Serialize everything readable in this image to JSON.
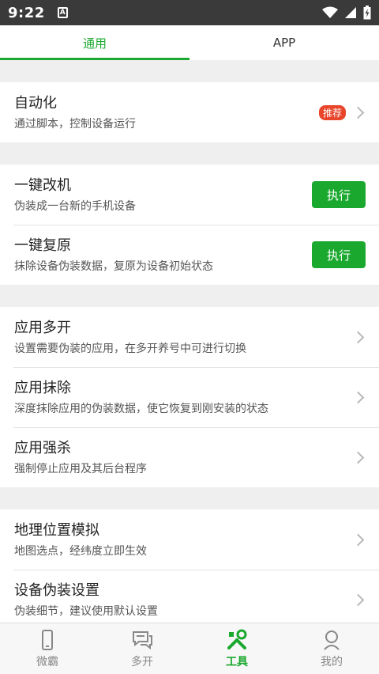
{
  "status": {
    "time": "9:22",
    "sim_icon": "A"
  },
  "tabs": [
    {
      "label": "通用",
      "active": true
    },
    {
      "label": "APP",
      "active": false
    }
  ],
  "automation": {
    "title": "自动化",
    "subtitle": "通过脚本，控制设备运行",
    "badge": "推荐"
  },
  "modify": {
    "title": "一键改机",
    "subtitle": "伪装成一台新的手机设备",
    "button": "执行"
  },
  "restore": {
    "title": "一键复原",
    "subtitle": "抹除设备伪装数据，复原为设备初始状态",
    "button": "执行"
  },
  "multi_open": {
    "title": "应用多开",
    "subtitle": "设置需要伪装的应用，在多开养号中可进行切换"
  },
  "app_erase": {
    "title": "应用抹除",
    "subtitle": "深度抹除应用的伪装数据，使它恢复到刚安装的状态"
  },
  "force_kill": {
    "title": "应用强杀",
    "subtitle": "强制停止应用及其后台程序"
  },
  "geo": {
    "title": "地理位置模拟",
    "subtitle": "地图选点，经纬度立即生效"
  },
  "disguise": {
    "title": "设备伪装设置",
    "subtitle": "伪装细节，建议使用默认设置"
  },
  "bottom_nav": [
    {
      "label": "微霸",
      "icon": "phone-icon"
    },
    {
      "label": "多开",
      "icon": "chat-icon"
    },
    {
      "label": "工具",
      "icon": "tools-icon",
      "active": true
    },
    {
      "label": "我的",
      "icon": "person-icon"
    }
  ],
  "colors": {
    "accent": "#1aa82e",
    "badge": "#e8452b",
    "statusbar": "#3a3a3a"
  }
}
